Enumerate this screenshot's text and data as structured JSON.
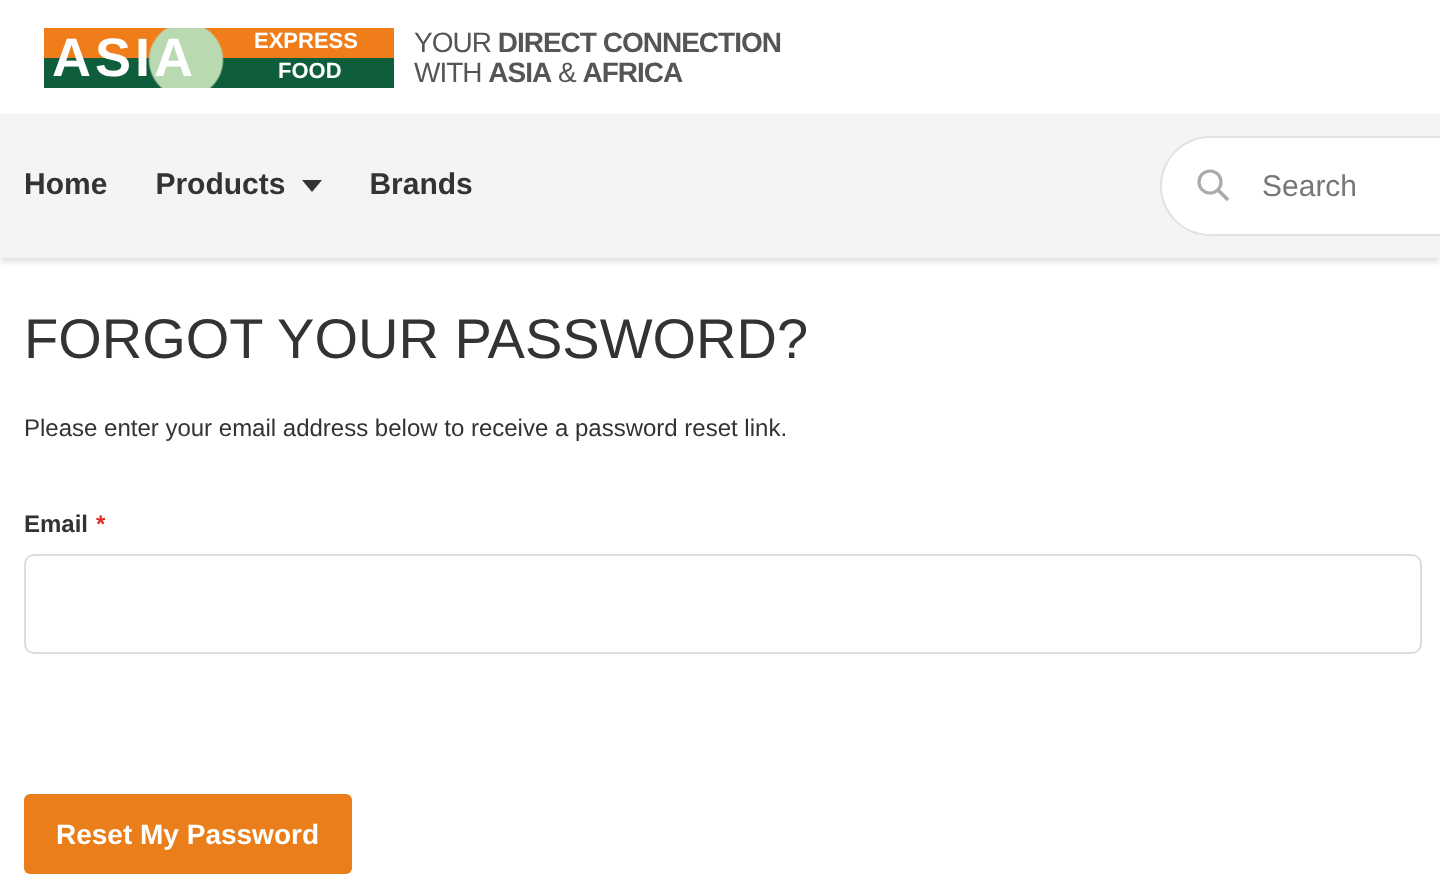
{
  "logo": {
    "main": "ASIA",
    "top": "EXPRESS",
    "bottom": "FOOD"
  },
  "tagline": [
    "YOUR **DIRECT CONNECTION**",
    "WITH **ASIA** & **AFRICA**"
  ],
  "nav": [
    {
      "label": "Home",
      "dropdown": false
    },
    {
      "label": "Products",
      "dropdown": true
    },
    {
      "label": "Brands",
      "dropdown": false
    }
  ],
  "search": {
    "placeholder": "Search"
  },
  "heading": "FORGOT YOUR PASSWORD?",
  "intro": "Please enter your email address below to receive a password reset link.",
  "email": {
    "label": "Email",
    "required_mark": "*",
    "required": true
  },
  "button": "Reset My Password"
}
